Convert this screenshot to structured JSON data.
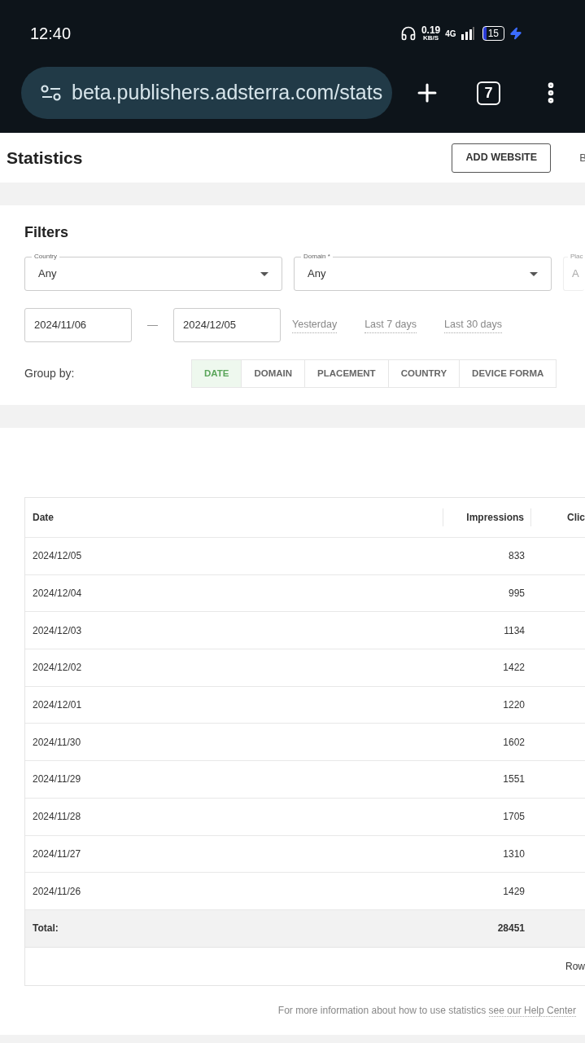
{
  "status_bar": {
    "time": "12:40",
    "speed": "0.19",
    "speed_unit": "KB/S",
    "network": "4G",
    "battery": "15"
  },
  "browser": {
    "url": "beta.publishers.adsterra.com/stats",
    "tab_count": "7"
  },
  "header": {
    "title": "Statistics",
    "add_button": "ADD WEBSITE",
    "next_button": "B"
  },
  "filters": {
    "title": "Filters",
    "selects": [
      {
        "label": "Country",
        "value": "Any",
        "disabled": false
      },
      {
        "label": "Domain *",
        "value": "Any",
        "disabled": false
      },
      {
        "label": "Plac",
        "value": "A",
        "disabled": true
      }
    ],
    "date_from": "2024/11/06",
    "separator": "—",
    "date_to": "2024/12/05",
    "quick_ranges": [
      "Yesterday",
      "Last 7 days",
      "Last 30 days"
    ],
    "group_by_label": "Group by:",
    "group_by": [
      {
        "label": "DATE",
        "selected": true
      },
      {
        "label": "DOMAIN",
        "selected": false
      },
      {
        "label": "PLACEMENT",
        "selected": false
      },
      {
        "label": "COUNTRY",
        "selected": false
      },
      {
        "label": "DEVICE FORMA",
        "selected": false
      }
    ]
  },
  "table": {
    "columns": [
      "Date",
      "Impressions",
      "Clic"
    ],
    "rows": [
      [
        "2024/12/05",
        "833"
      ],
      [
        "2024/12/04",
        "995"
      ],
      [
        "2024/12/03",
        "1134"
      ],
      [
        "2024/12/02",
        "1422"
      ],
      [
        "2024/12/01",
        "1220"
      ],
      [
        "2024/11/30",
        "1602"
      ],
      [
        "2024/11/29",
        "1551"
      ],
      [
        "2024/11/28",
        "1705"
      ],
      [
        "2024/11/27",
        "1310"
      ],
      [
        "2024/11/26",
        "1429"
      ]
    ],
    "total": [
      "Total:",
      "28451"
    ],
    "pagination": "Row"
  },
  "footer": {
    "text": "For more information about how to use statistics",
    "link": "see our Help Center"
  }
}
